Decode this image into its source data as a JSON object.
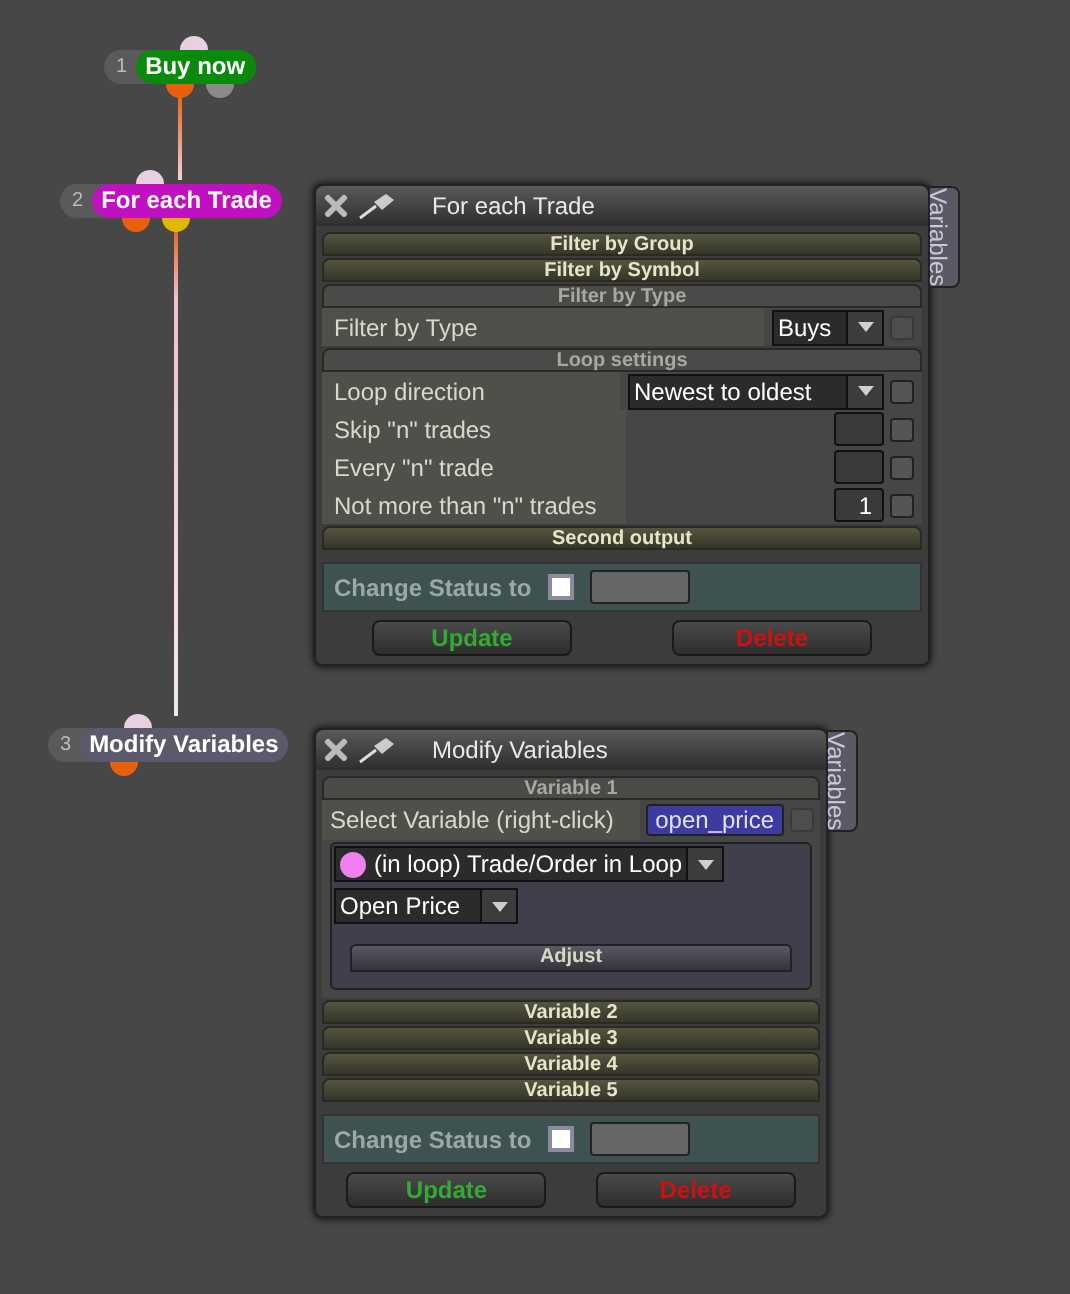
{
  "nodes": [
    {
      "number": "1",
      "label": "Buy now",
      "color": "#0a8a0a",
      "ports": [
        {
          "color": "#e8600c"
        },
        {
          "color": "#8a8a8a"
        }
      ]
    },
    {
      "number": "2",
      "label": "For each Trade",
      "color": "#c010c0",
      "ports": [
        {
          "color": "#e8600c"
        },
        {
          "color": "#e0b800"
        }
      ]
    },
    {
      "number": "3",
      "label": "Modify Variables",
      "color": "#5a5a6c",
      "ports": [
        {
          "color": "#e8600c"
        }
      ]
    }
  ],
  "panels": [
    {
      "title": "For each Trade",
      "tab": "Variables",
      "sections": [
        {
          "label": "Filter by Group",
          "expanded": false
        },
        {
          "label": "Filter by Symbol",
          "expanded": false
        },
        {
          "label": "Filter by Type",
          "expanded": true,
          "rows": [
            {
              "kind": "dropdown",
              "label": "Filter by Type",
              "value": "Buys",
              "checked": false,
              "disabled": true
            }
          ]
        },
        {
          "label": "Loop settings",
          "expanded": true,
          "rows": [
            {
              "kind": "dropdown",
              "label": "Loop direction",
              "value": "Newest to oldest",
              "checked": false,
              "disabled": false
            },
            {
              "kind": "number",
              "label": "Skip \"n\" trades",
              "value": "",
              "checked": false
            },
            {
              "kind": "number",
              "label": "Every \"n\" trade",
              "value": "",
              "checked": false
            },
            {
              "kind": "number",
              "label": "Not more than \"n\" trades",
              "value": "1",
              "checked": false
            }
          ]
        },
        {
          "label": "Second output",
          "expanded": false
        }
      ],
      "status": {
        "label": "Change Status to",
        "checked": false
      },
      "buttons": [
        {
          "label": "Update",
          "kind": "update"
        },
        {
          "label": "Delete",
          "kind": "delete"
        }
      ]
    },
    {
      "title": "Modify Variables",
      "tab": "Variables",
      "sections": [
        {
          "label": "Variable 1",
          "expanded": true,
          "rows": [
            {
              "kind": "variable",
              "label": "Select Variable (right-click)",
              "value": "open_price",
              "checked": false
            },
            {
              "kind": "source",
              "source": {
                "value": "(in loop) Trade/Order in Loop",
                "color": "#f080f0"
              },
              "field": "Open Price",
              "action": "Adjust"
            }
          ]
        },
        {
          "label": "Variable 2",
          "expanded": false
        },
        {
          "label": "Variable 3",
          "expanded": false
        },
        {
          "label": "Variable 4",
          "expanded": false
        },
        {
          "label": "Variable 5",
          "expanded": false
        }
      ],
      "status": {
        "label": "Change Status to",
        "checked": false
      },
      "buttons": [
        {
          "label": "Update",
          "kind": "update"
        },
        {
          "label": "Delete",
          "kind": "delete"
        }
      ]
    }
  ]
}
